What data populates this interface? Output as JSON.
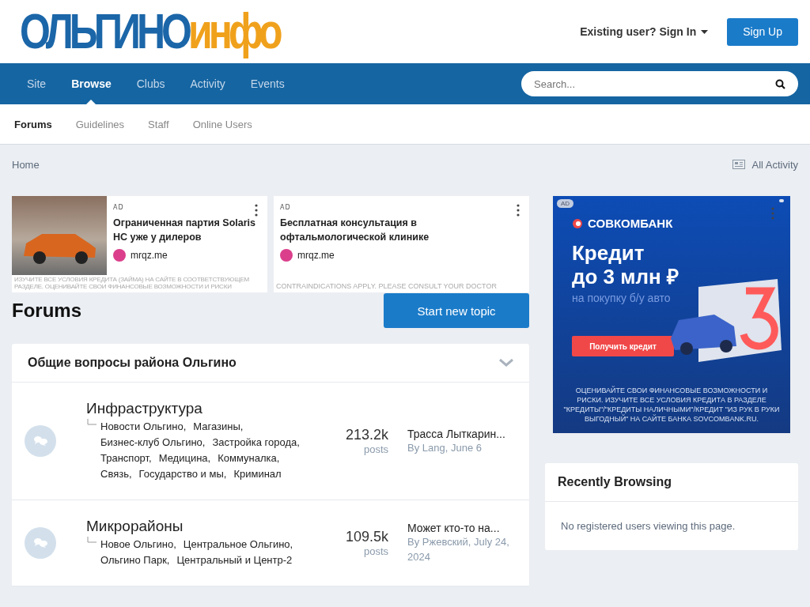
{
  "header": {
    "logo": {
      "main": "ОЛЬГИНО",
      "accent": "инфо"
    },
    "sign_in": "Existing user? Sign In",
    "sign_up": "Sign Up"
  },
  "nav": {
    "tabs": [
      {
        "label": "Site",
        "selected": false
      },
      {
        "label": "Browse",
        "selected": true
      },
      {
        "label": "Clubs",
        "selected": false
      },
      {
        "label": "Activity",
        "selected": false
      },
      {
        "label": "Events",
        "selected": false
      }
    ],
    "search": {
      "placeholder": "Search..."
    }
  },
  "subnav": [
    {
      "label": "Forums",
      "selected": true
    },
    {
      "label": "Guidelines",
      "selected": false
    },
    {
      "label": "Staff",
      "selected": false
    },
    {
      "label": "Online Users",
      "selected": false
    }
  ],
  "breadcrumb": {
    "home": "Home",
    "all_activity": "All Activity"
  },
  "ads": [
    {
      "badge": "AD",
      "has_photo": true,
      "title": "Ограниченная партия Solaris HC уже у дилеров",
      "domain": "mrqz.me",
      "disclaimer": "ИЗУЧИТЕ ВСЕ УСЛОВИЯ КРЕДИТА (ЗАЙМА) НА САЙТЕ В СООТВЕТСТВУЮЩЕМ РАЗДЕЛЕ. ОЦЕНИВАЙТЕ СВОИ ФИНАНСОВЫЕ ВОЗМОЖНОСТИ И РИСКИ"
    },
    {
      "badge": "AD",
      "has_photo": false,
      "title": "Бесплатная консультация в офтальмологической клинике",
      "domain": "mrqz.me",
      "disclaimer": "CONTRAINDICATIONS APPLY. PLEASE CONSULT YOUR DOCTOR"
    }
  ],
  "page_title": "Forums",
  "start_topic": "Start new topic",
  "category": {
    "title": "Общие вопросы района Ольгино",
    "expanded": true,
    "forums": [
      {
        "title": "Инфраструктура",
        "subforums": [
          "Новости Ольгино,",
          "Магазины,",
          "Бизнес-клуб Ольгино,",
          "Застройка города,",
          "Транспорт,",
          "Медицина,",
          "Коммуналка,",
          "Связь,",
          "Государство и мы,",
          "Криминал"
        ],
        "count": "213.2k",
        "count_label": "posts",
        "last_title": "Трасса Лыткарин...",
        "last_by": "By Lang, June 6"
      },
      {
        "title": "Микрорайоны",
        "subforums": [
          "Новое Ольгино,",
          "Центральное Ольгино,",
          "Ольгино Парк,",
          "Центральный и Центр-2"
        ],
        "count": "109.5k",
        "count_label": "posts",
        "last_title": "Может кто-то на...",
        "last_by": "By Ржевский, July 24, 2024"
      }
    ]
  },
  "side_ad": {
    "badge": "AD",
    "brand": "СОВКОМБАНК",
    "headline": "Кредит\nдо 3 млн ₽",
    "subline": "на покупку б/у авто",
    "button": "Получить кредит",
    "fine_print": "ОЦЕНИВАЙТЕ СВОИ ФИНАНСОВЫЕ ВОЗМОЖНОСТИ И РИСКИ. ИЗУЧИТЕ ВСЕ УСЛОВИЯ КРЕДИТА В РАЗДЕЛЕ \"КРЕДИТЫ\"/\"КРЕДИТЫ НАЛИЧНЫМИ\"/КРЕДИТ \"ИЗ РУК В РУКИ ВЫГОДНЫЙ\" НА САЙТЕ БАНКА SOVCOMBANK.RU."
  },
  "recently_browsing": {
    "title": "Recently Browsing",
    "message": "No registered users viewing this page."
  }
}
